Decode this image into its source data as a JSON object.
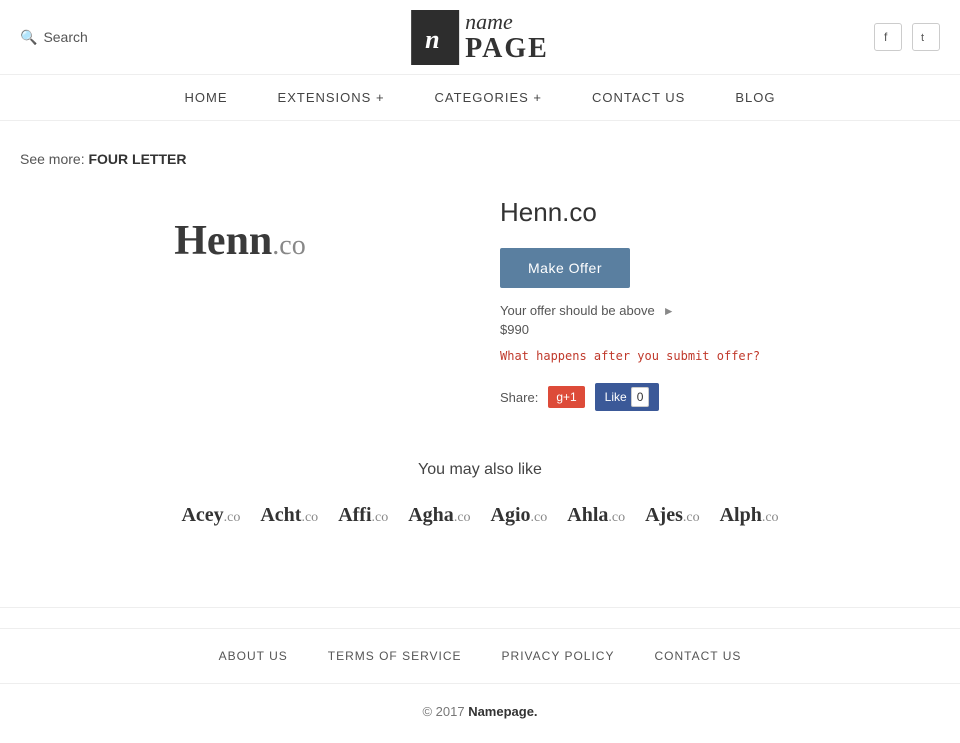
{
  "header": {
    "search_label": "Search",
    "logo_icon_text": "n",
    "logo_name": "name",
    "logo_page": "PAGE",
    "social": [
      {
        "name": "facebook",
        "icon": "f"
      },
      {
        "name": "twitter",
        "icon": "t"
      }
    ]
  },
  "nav": {
    "items": [
      {
        "id": "home",
        "label": "HOME"
      },
      {
        "id": "extensions",
        "label": "EXTENSIONS +"
      },
      {
        "id": "categories",
        "label": "CATEGORIES +"
      },
      {
        "id": "contact",
        "label": "CONTACT US"
      },
      {
        "id": "blog",
        "label": "BLOG"
      }
    ]
  },
  "breadcrumb": {
    "prefix": "See more:",
    "link_text": "FOUR LETTER"
  },
  "domain": {
    "display_name": "Henn",
    "extension": ".co",
    "full_name": "Henn.co",
    "make_offer_label": "Make Offer",
    "offer_hint": "Your offer should be above",
    "offer_price": "$990",
    "what_happens": "What happens after you submit offer?",
    "share_label": "Share:",
    "google_plus_label": "g+1",
    "fb_like_label": "Like",
    "fb_like_count": "0"
  },
  "also_like": {
    "title": "You may also like",
    "domains": [
      {
        "name": "Acey",
        "ext": ".co"
      },
      {
        "name": "Acht",
        "ext": ".co"
      },
      {
        "name": "Affi",
        "ext": ".co"
      },
      {
        "name": "Agha",
        "ext": ".co"
      },
      {
        "name": "Agio",
        "ext": ".co"
      },
      {
        "name": "Ahla",
        "ext": ".co"
      },
      {
        "name": "Ajes",
        "ext": ".co"
      },
      {
        "name": "Alph",
        "ext": ".co"
      }
    ]
  },
  "footer": {
    "links": [
      {
        "id": "about",
        "label": "ABOUT US"
      },
      {
        "id": "terms",
        "label": "TERMS OF SERVICE"
      },
      {
        "id": "privacy",
        "label": "PRIVACY POLICY"
      },
      {
        "id": "contact",
        "label": "CONTACT US"
      }
    ],
    "copyright": "© 2017",
    "brand": "Namepage."
  }
}
